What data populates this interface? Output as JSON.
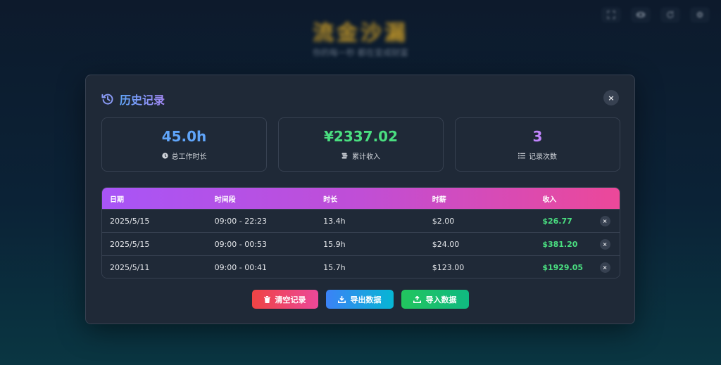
{
  "background": {
    "app_title": "流金沙漏",
    "app_subtitle": "你的每一秒 都在变成财富"
  },
  "toolbar": {
    "icons": [
      "fullscreen-icon",
      "eye-icon",
      "refresh-icon",
      "settings-icon"
    ]
  },
  "modal": {
    "title": "历史记录",
    "close_label": "×",
    "stats": [
      {
        "value": "45.0h",
        "label": "总工作时长",
        "icon": "clock-icon",
        "color": "#60a5fa"
      },
      {
        "value": "¥2337.02",
        "label": "累计收入",
        "icon": "coins-icon",
        "color": "#4ade80"
      },
      {
        "value": "3",
        "label": "记录次数",
        "icon": "list-icon",
        "color": "#c084fc"
      }
    ],
    "table": {
      "headers": [
        "日期",
        "时间段",
        "时长",
        "时薪",
        "收入"
      ],
      "rows": [
        {
          "date": "2025/5/15",
          "period": "09:00 - 22:23",
          "duration": "13.4h",
          "rate": "$2.00",
          "income": "$26.77",
          "delete": "×"
        },
        {
          "date": "2025/5/15",
          "period": "09:00 - 00:53",
          "duration": "15.9h",
          "rate": "$24.00",
          "income": "$381.20",
          "delete": "×"
        },
        {
          "date": "2025/5/11",
          "period": "09:00 - 00:41",
          "duration": "15.7h",
          "rate": "$123.00",
          "income": "$1929.05",
          "delete": "×"
        }
      ]
    },
    "actions": {
      "clear": "清空记录",
      "export": "导出数据",
      "import": "导入数据"
    }
  },
  "colors": {
    "accent_blue": "#60a5fa",
    "accent_green": "#4ade80",
    "accent_purple": "#c084fc",
    "header_gradient_start": "#a855f7",
    "header_gradient_end": "#ec4899"
  }
}
